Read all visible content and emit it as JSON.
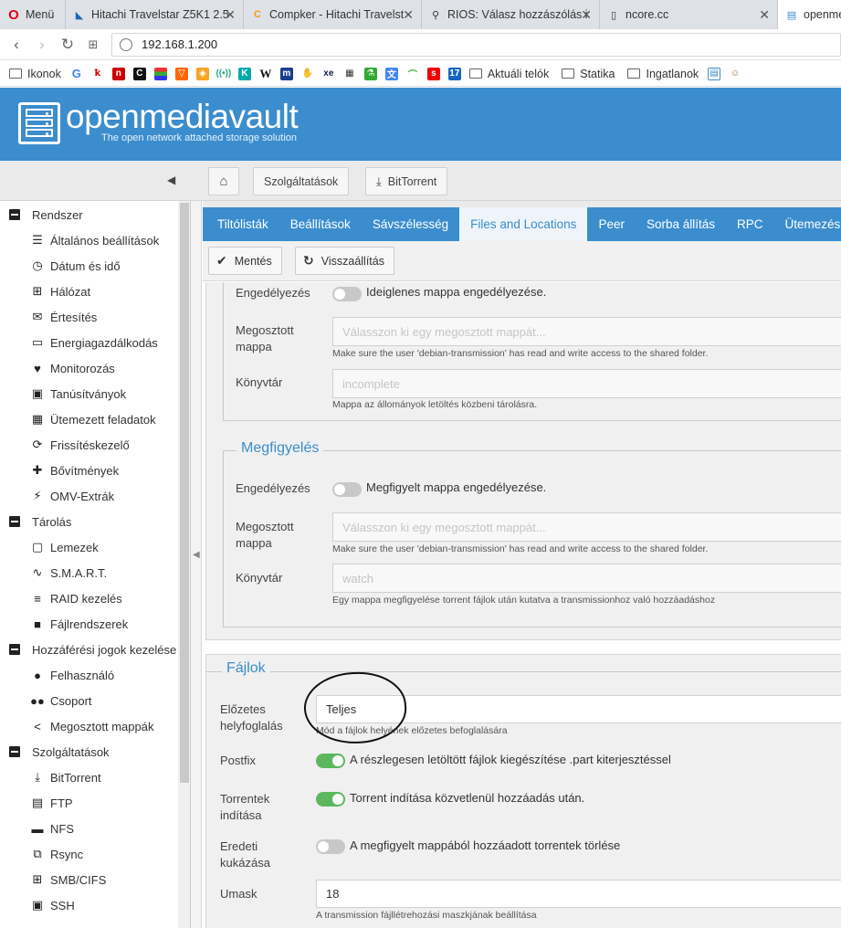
{
  "browser": {
    "tabs": [
      {
        "label": "Menü"
      },
      {
        "label": "Hitachi Travelstar Z5K1 2.5"
      },
      {
        "label": "Compker - Hitachi Travelst"
      },
      {
        "label": "RIOS: Válasz hozzászólás i"
      },
      {
        "label": "ncore.cc"
      },
      {
        "label": "openme"
      }
    ],
    "url": "192.168.1.200",
    "bookmarks": {
      "ikonok": "Ikonok",
      "aktualis": "Aktuáli telók",
      "statika": "Statika",
      "ingatlanok": "Ingatlanok"
    }
  },
  "header": {
    "brand": "openmediavault",
    "tagline": "The open network attached storage solution",
    "color": "#3b8dcd"
  },
  "breadcrumb": {
    "home_icon": "home-icon",
    "services": "Szolgáltatások",
    "bittorrent": "BitTorrent"
  },
  "sidebar": {
    "groups": {
      "rendszer": "Rendszer",
      "tarolas": "Tárolás",
      "hozzaferes": "Hozzáférési jogok kezelése",
      "szolgaltatasok": "Szolgáltatások"
    },
    "items": {
      "altalanos": "Általános beállítások",
      "datum": "Dátum és idő",
      "halozat": "Hálózat",
      "ertesites": "Értesítés",
      "energia": "Energiagazdálkodás",
      "monitor": "Monitorozás",
      "tanusitvany": "Tanúsítványok",
      "utemezett": "Ütemezett feladatok",
      "frissites": "Frissítéskezelő",
      "bovitmeny": "Bővítmények",
      "omvextra": "OMV-Extrák",
      "lemezek": "Lemezek",
      "smart": "S.M.A.R.T.",
      "raid": "RAID kezelés",
      "fajlrendszer": "Fájlrendszerek",
      "felhasznalo": "Felhasználó",
      "csoport": "Csoport",
      "megosztott": "Megosztott mappák",
      "bittorrent": "BitTorrent",
      "ftp": "FTP",
      "nfs": "NFS",
      "rsync": "Rsync",
      "smb": "SMB/CIFS",
      "ssh": "SSH"
    }
  },
  "tabs": {
    "tiltolistak": "Tiltólisták",
    "beallitasok": "Beállítások",
    "savszelesseg": "Sávszélesség",
    "files": "Files and Locations",
    "peer": "Peer",
    "sorba": "Sorba állítás",
    "rpc": "RPC",
    "utemezes": "Ütemezés"
  },
  "actions": {
    "save": "Mentés",
    "revert": "Visszaállítás"
  },
  "incomplete": {
    "enable_label": "Engedélyezés",
    "enable_text": "Ideiglenes mappa engedélyezése.",
    "shared_label": "Megosztott mappa",
    "shared_placeholder": "Válasszon ki egy megosztott mappát...",
    "shared_hint": "Make sure the user 'debian-transmission' has read and write access to the shared folder.",
    "dir_label": "Könyvtár",
    "dir_placeholder": "incomplete",
    "dir_hint": "Mappa az állományok letöltés közbeni tárolásra."
  },
  "watch": {
    "legend": "Megfigyelés",
    "enable_label": "Engedélyezés",
    "enable_text": "Megfigyelt mappa engedélyezése.",
    "shared_label": "Megosztott mappa",
    "shared_placeholder": "Válasszon ki egy megosztott mappát...",
    "shared_hint": "Make sure the user 'debian-transmission' has read and write access to the shared folder.",
    "dir_label": "Könyvtár",
    "dir_placeholder": "watch",
    "dir_hint": "Egy mappa megfigyelése torrent fájlok után kutatva a transmissionhoz való hozzáadáshoz"
  },
  "files": {
    "legend": "Fájlok",
    "prealloc_label": "Előzetes helyfoglalás",
    "prealloc_value": "Teljes",
    "prealloc_hint": "Mód a fájlok helyének előzetes befoglalására",
    "postfix_label": "Postfix",
    "postfix_text": "A részlegesen letöltött fájlok kiegészítése .part kiterjesztéssel",
    "postfix_on": true,
    "start_label": "Torrentek indítása",
    "start_text": "Torrent indítása közvetlenül hozzáadás után.",
    "start_on": true,
    "trash_label": "Eredeti kukázása",
    "trash_text": "A megfigyelt mappából hozzáadott torrentek törlése",
    "trash_on": false,
    "umask_label": "Umask",
    "umask_value": "18",
    "umask_hint": "A transmission fájllétrehozási maszkjának beállítása"
  }
}
